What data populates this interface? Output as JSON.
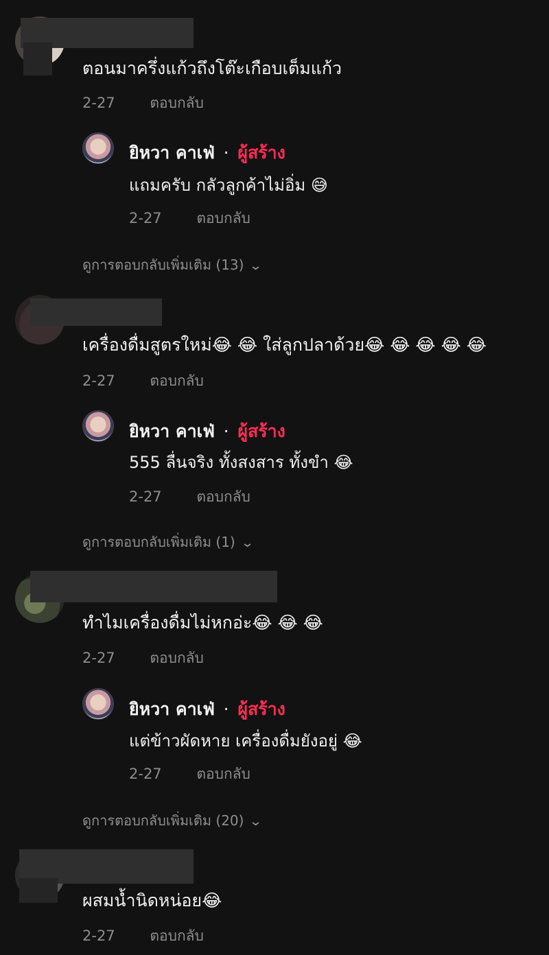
{
  "colors": {
    "background": "#121212",
    "creator_badge": "#fe2c55",
    "muted": "#8e8e8e"
  },
  "comments": [
    {
      "text": "ตอนมาครึ่งแก้วถึงโต๊ะเกือบเต็มแก้ว",
      "date": "2-27",
      "reply_label": "ตอบกลับ",
      "creator_reply": {
        "name": "ยิหวา คาเฟ่",
        "dot": "·",
        "badge": "ผู้สร้าง",
        "text": "แถมครับ กลัวลูกค้าไม่อิ่ม 😅",
        "date": "2-27",
        "reply_label": "ตอบกลับ"
      },
      "more_replies": "ดูการตอบกลับเพิ่มเติม (13)"
    },
    {
      "text": "เครื่องดื่มสูตรใหม่😂 😂 ใส่ลูกปลาด้วย😂 😂 😂 😂 😂",
      "date": "2-27",
      "reply_label": "ตอบกลับ",
      "creator_reply": {
        "name": "ยิหวา คาเฟ่",
        "dot": "·",
        "badge": "ผู้สร้าง",
        "text": "555 ลื่นจริง ทั้งสงสาร ทั้งขำ 😂",
        "date": "2-27",
        "reply_label": "ตอบกลับ"
      },
      "more_replies": "ดูการตอบกลับเพิ่มเติม (1)"
    },
    {
      "text": "ทำไมเครื่องดื่มไม่หกอ่ะ😂 😂 😂",
      "date": "2-27",
      "reply_label": "ตอบกลับ",
      "creator_reply": {
        "name": "ยิหวา คาเฟ่",
        "dot": "·",
        "badge": "ผู้สร้าง",
        "text": "แต่ข้าวผัดหาย เครื่องดื่มยังอยู่ 😂",
        "date": "2-27",
        "reply_label": "ตอบกลับ"
      },
      "more_replies": "ดูการตอบกลับเพิ่มเติม (20)"
    },
    {
      "text": "ผสมน้ำนิดหน่อย😂",
      "date": "2-27",
      "reply_label": "ตอบกลับ"
    }
  ],
  "icons": {
    "expand": "chevron-down-icon"
  }
}
